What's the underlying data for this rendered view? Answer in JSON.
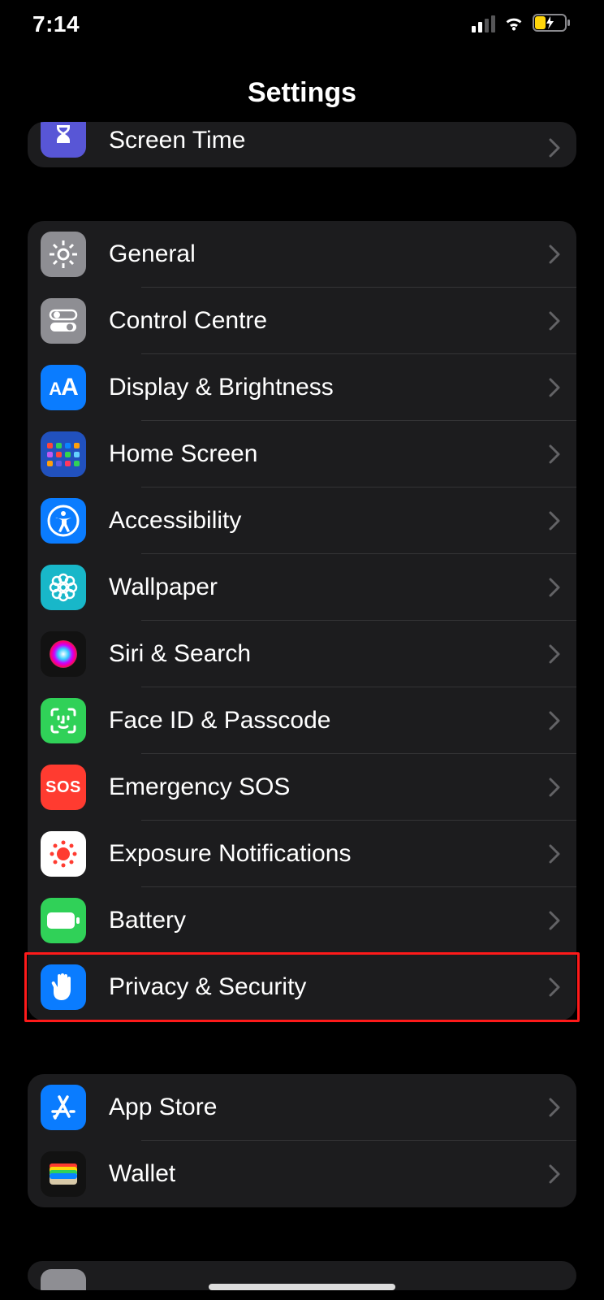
{
  "status": {
    "time": "7:14"
  },
  "header": {
    "title": "Settings"
  },
  "groups": [
    {
      "clippedTop": true,
      "items": [
        {
          "key": "screen-time",
          "label": "Screen Time",
          "icon": "hourglass-icon",
          "bg": "#5856d6"
        }
      ]
    },
    {
      "items": [
        {
          "key": "general",
          "label": "General",
          "icon": "gear-icon",
          "bg": "#8e8e93"
        },
        {
          "key": "control-centre",
          "label": "Control Centre",
          "icon": "toggles-icon",
          "bg": "#8e8e93"
        },
        {
          "key": "display-brightness",
          "label": "Display & Brightness",
          "icon": "text-size-icon",
          "bg": "#0a7cff"
        },
        {
          "key": "home-screen",
          "label": "Home Screen",
          "icon": "apps-grid-icon",
          "bg": "#2151be"
        },
        {
          "key": "accessibility",
          "label": "Accessibility",
          "icon": "accessibility-icon",
          "bg": "#0a7cff"
        },
        {
          "key": "wallpaper",
          "label": "Wallpaper",
          "icon": "flower-icon",
          "bg": "#18b7c9"
        },
        {
          "key": "siri-search",
          "label": "Siri & Search",
          "icon": "siri-icon",
          "bg": "#121212"
        },
        {
          "key": "face-id-passcode",
          "label": "Face ID & Passcode",
          "icon": "face-id-icon",
          "bg": "#30d158"
        },
        {
          "key": "emergency-sos",
          "label": "Emergency SOS",
          "icon": "sos-icon",
          "bg": "#ff3b30"
        },
        {
          "key": "exposure-notifications",
          "label": "Exposure Notifications",
          "icon": "exposure-icon",
          "bg": "#ffffff"
        },
        {
          "key": "battery",
          "label": "Battery",
          "icon": "battery-icon",
          "bg": "#30d158"
        },
        {
          "key": "privacy-security",
          "label": "Privacy & Security",
          "icon": "hand-icon",
          "bg": "#0a7cff",
          "highlight": true
        }
      ]
    },
    {
      "items": [
        {
          "key": "app-store",
          "label": "App Store",
          "icon": "appstore-icon",
          "bg": "#0a7cff"
        },
        {
          "key": "wallet",
          "label": "Wallet",
          "icon": "wallet-icon",
          "bg": "#121212"
        }
      ]
    }
  ]
}
